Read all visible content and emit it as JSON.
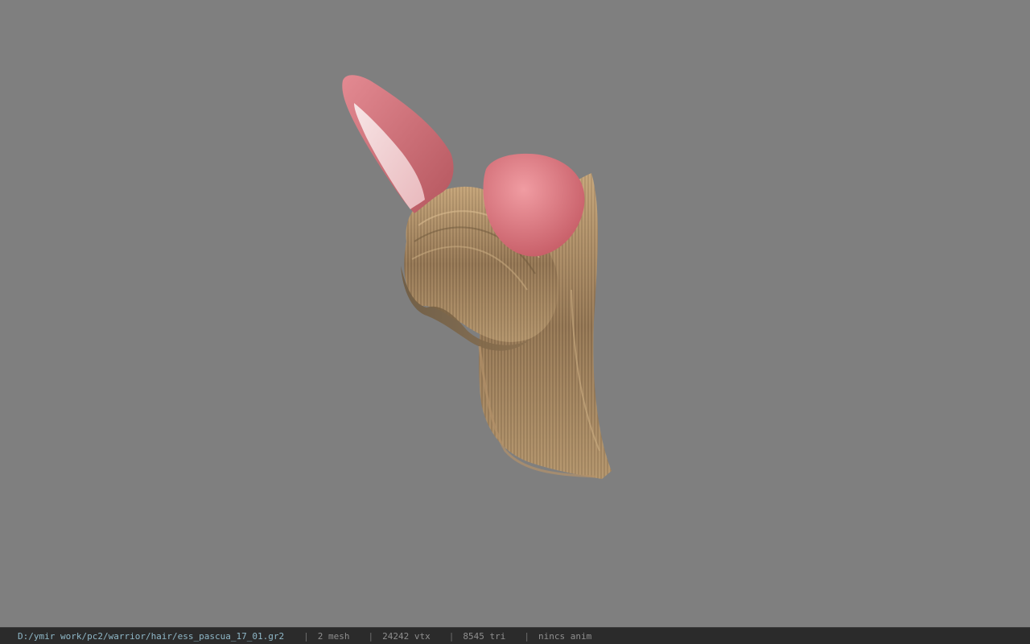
{
  "viewport": {
    "background_color": "#7f7f7f",
    "model": {
      "icon": "bunny-ear-hair-model",
      "colors": {
        "ear_outer": "#d9727a",
        "ear_inner": "#f0d2d4",
        "hair": "#a48458",
        "hair_shadow": "#6f5a3e"
      }
    }
  },
  "statusbar": {
    "file_path": "D:/ymir work/pc2/warrior/hair/ess_pascua_17_01.gr2",
    "separator": "|",
    "mesh": "2 mesh",
    "vertices": "24242 vtx",
    "triangles": "8545 tri",
    "anim": "nincs anim"
  }
}
